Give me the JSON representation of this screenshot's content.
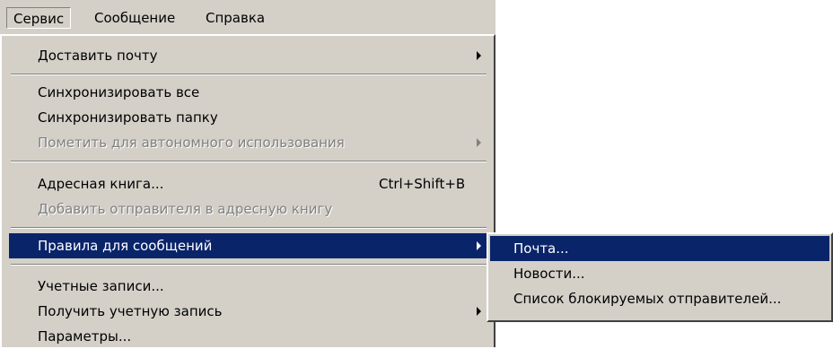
{
  "menubar": {
    "items": [
      {
        "label": "Сервис"
      },
      {
        "label": "Сообщение"
      },
      {
        "label": "Справка"
      }
    ]
  },
  "menu": {
    "items": [
      {
        "label": "Доставить почту",
        "submenu": true,
        "enabled": true
      },
      {
        "label": "Синхронизировать все",
        "enabled": true
      },
      {
        "label": "Синхронизировать папку",
        "enabled": true
      },
      {
        "label": "Пометить для автономного использования",
        "submenu": true,
        "enabled": false
      },
      {
        "label": "Адресная книга...",
        "shortcut": "Ctrl+Shift+B",
        "enabled": true
      },
      {
        "label": "Добавить отправителя в адресную книгу",
        "enabled": false
      },
      {
        "label": "Правила для сообщений",
        "submenu": true,
        "enabled": true,
        "highlighted": true
      },
      {
        "label": "Учетные записи...",
        "enabled": true
      },
      {
        "label": "Получить учетную запись",
        "submenu": true,
        "enabled": true
      },
      {
        "label": "Параметры...",
        "enabled": true
      }
    ]
  },
  "submenu": {
    "items": [
      {
        "label": "Почта...",
        "highlighted": true
      },
      {
        "label": "Новости..."
      },
      {
        "label": "Список блокируемых отправителей..."
      }
    ]
  },
  "colors": {
    "menu_background": "#d4d0c8",
    "highlight": "#0a246a",
    "disabled_text": "#808080"
  }
}
